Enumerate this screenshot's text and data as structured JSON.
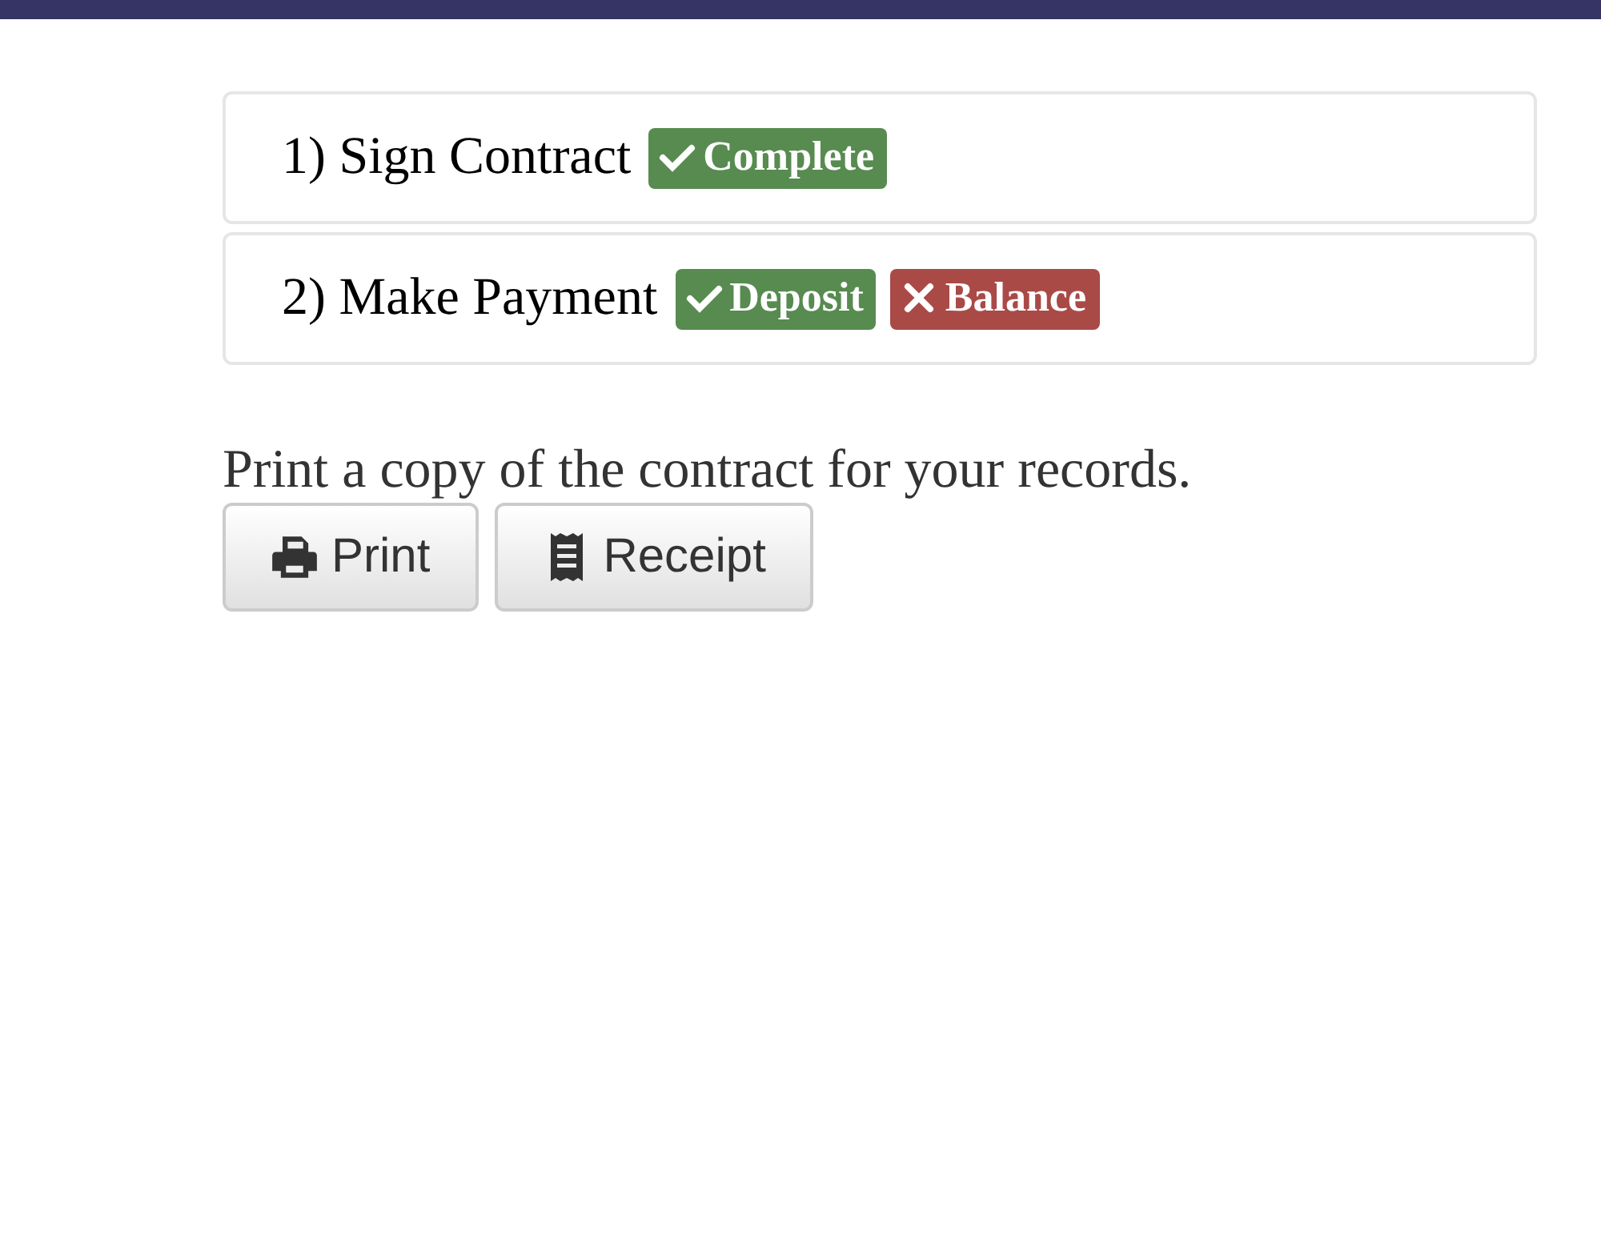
{
  "steps": [
    {
      "label": "1) Sign Contract",
      "badges": [
        {
          "text": "Complete",
          "complete": true
        }
      ]
    },
    {
      "label": "2) Make Payment",
      "badges": [
        {
          "text": "Deposit",
          "complete": true
        },
        {
          "text": "Balance",
          "complete": false
        }
      ]
    }
  ],
  "note": "Print a copy of the contract for your records.",
  "buttons": [
    {
      "label": "Print",
      "kind": "print"
    },
    {
      "label": "Receipt",
      "kind": "receipt"
    }
  ]
}
